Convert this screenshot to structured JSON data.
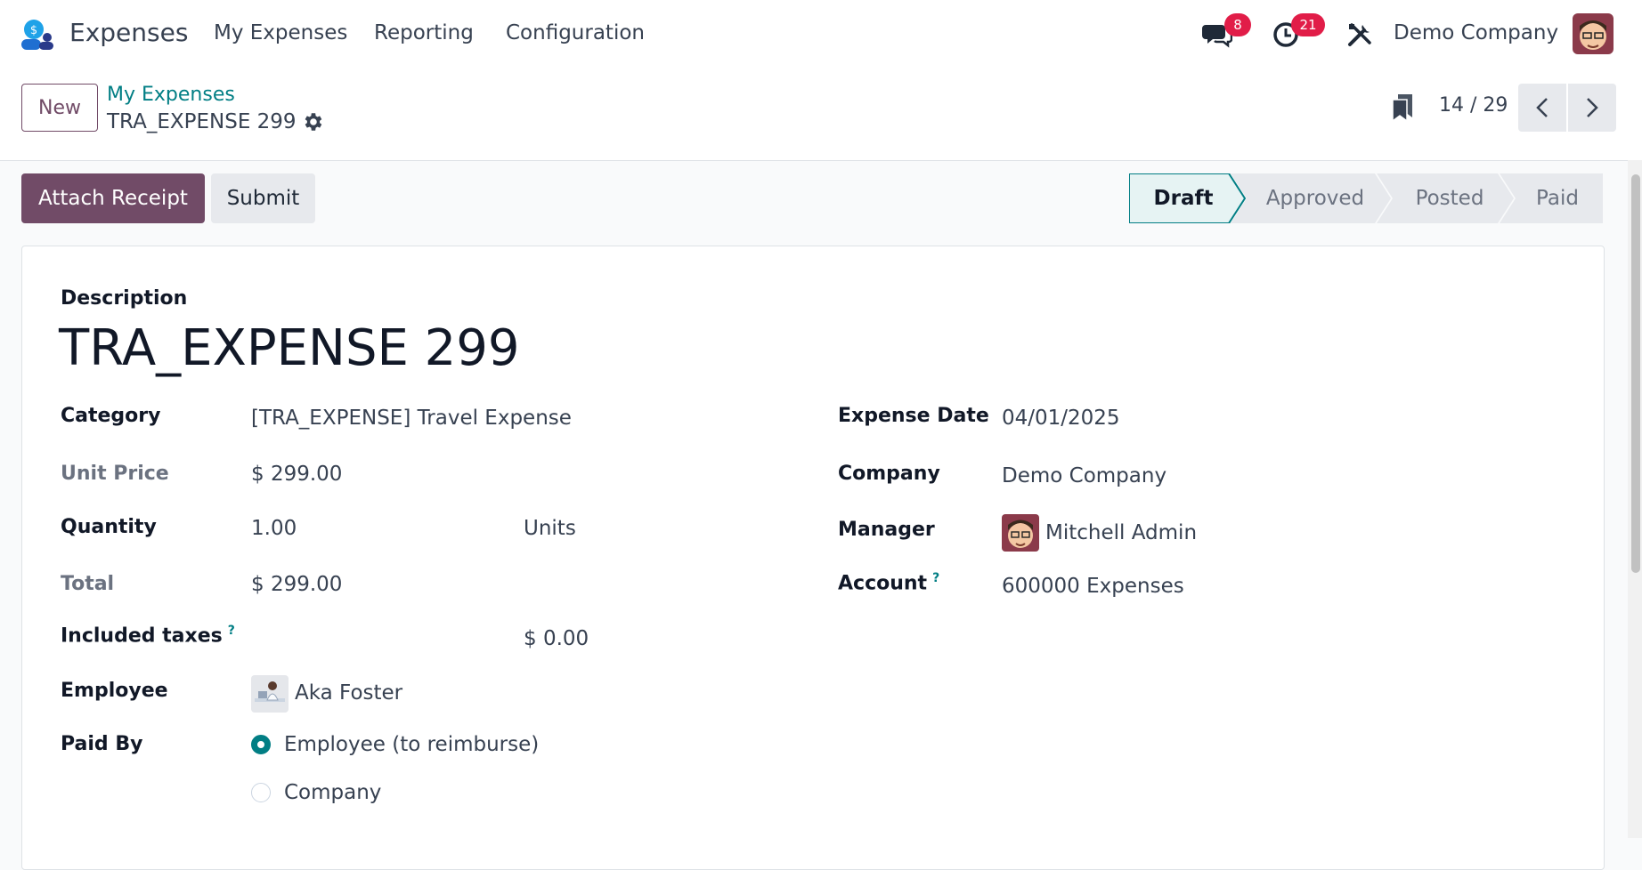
{
  "navbar": {
    "app_name": "Expenses",
    "menu": [
      "My Expenses",
      "Reporting",
      "Configuration"
    ],
    "messages_count": "8",
    "activities_count": "21",
    "company": "Demo Company"
  },
  "control_panel": {
    "new_label": "New",
    "breadcrumb_parent": "My Expenses",
    "breadcrumb_current": "TRA_EXPENSE 299",
    "pager": "14 / 29"
  },
  "actions": {
    "attach_receipt": "Attach Receipt",
    "submit": "Submit"
  },
  "statusbar": {
    "stages": [
      "Draft",
      "Approved",
      "Posted",
      "Paid"
    ],
    "active": "Draft"
  },
  "form": {
    "description_label": "Description",
    "description": "TRA_EXPENSE 299",
    "category_label": "Category",
    "category": "[TRA_EXPENSE] Travel Expense",
    "unit_price_label": "Unit Price",
    "unit_price": "$ 299.00",
    "quantity_label": "Quantity",
    "quantity": "1.00",
    "uom": "Units",
    "total_label": "Total",
    "total": "$ 299.00",
    "included_taxes_label": "Included taxes",
    "included_taxes": "$ 0.00",
    "employee_label": "Employee",
    "employee": "Aka Foster",
    "paid_by_label": "Paid By",
    "paid_by_options": [
      "Employee (to reimburse)",
      "Company"
    ],
    "paid_by_selected": "Employee (to reimburse)",
    "expense_date_label": "Expense Date",
    "expense_date": "04/01/2025",
    "company_label": "Company",
    "company": "Demo Company",
    "manager_label": "Manager",
    "manager": "Mitchell Admin",
    "account_label": "Account",
    "account": "600000 Expenses",
    "help_mark": "?"
  },
  "colors": {
    "brand": "#714b67",
    "link": "#017e84",
    "badge": "#e11d48"
  }
}
